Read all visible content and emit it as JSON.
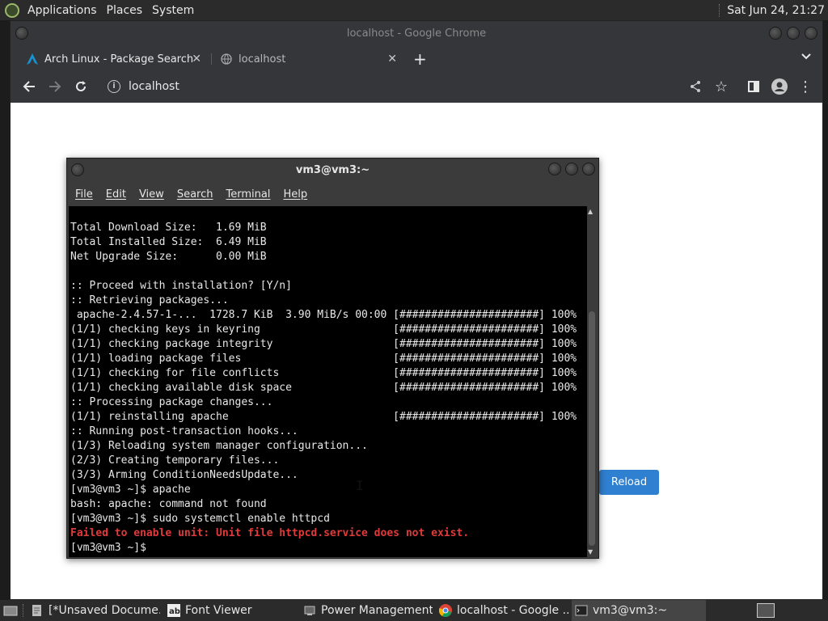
{
  "top_panel": {
    "menus": [
      "Applications",
      "Places",
      "System"
    ],
    "clock": "Sat Jun 24, 21:27"
  },
  "chrome": {
    "window_title": "localhost - Google Chrome",
    "tabs": [
      {
        "label": "Arch Linux - Package Search",
        "icon": "arch-linux-icon",
        "active": true
      },
      {
        "label": "localhost",
        "icon": "globe-icon",
        "active": false
      }
    ],
    "url": "localhost",
    "reload_button": "Reload"
  },
  "terminal": {
    "title": "vm3@vm3:~",
    "menu": [
      "File",
      "Edit",
      "View",
      "Search",
      "Terminal",
      "Help"
    ],
    "lines": [
      "Total Download Size:   1.69 MiB",
      "Total Installed Size:  6.49 MiB",
      "Net Upgrade Size:      0.00 MiB",
      "",
      ":: Proceed with installation? [Y/n]",
      ":: Retrieving packages...",
      " apache-2.4.57-1-...  1728.7 KiB  3.90 MiB/s 00:00 [######################] 100%",
      "(1/1) checking keys in keyring                     [######################] 100%",
      "(1/1) checking package integrity                   [######################] 100%",
      "(1/1) loading package files                        [######################] 100%",
      "(1/1) checking for file conflicts                  [######################] 100%",
      "(1/1) checking available disk space                [######################] 100%",
      ":: Processing package changes...",
      "(1/1) reinstalling apache                          [######################] 100%",
      ":: Running post-transaction hooks...",
      "(1/3) Reloading system manager configuration...",
      "(2/3) Creating temporary files...",
      "(3/3) Arming ConditionNeedsUpdate...",
      "[vm3@vm3 ~]$ apache",
      "bash: apache: command not found",
      "[vm3@vm3 ~]$ sudo systemctl enable httpcd"
    ],
    "error_line": "Failed to enable unit: Unit file httpcd.service does not exist.",
    "prompt": "[vm3@vm3 ~]$ "
  },
  "taskbar": {
    "items": [
      {
        "label": "[*Unsaved Docume...",
        "icon": "text-editor-icon"
      },
      {
        "label": "Font Viewer",
        "icon": "font-viewer-icon"
      },
      {
        "label": "Power Management...",
        "icon": "power-icon"
      },
      {
        "label": "localhost - Google ...",
        "icon": "chrome-icon"
      },
      {
        "label": "vm3@vm3:~",
        "icon": "terminal-icon",
        "active": true
      }
    ]
  }
}
